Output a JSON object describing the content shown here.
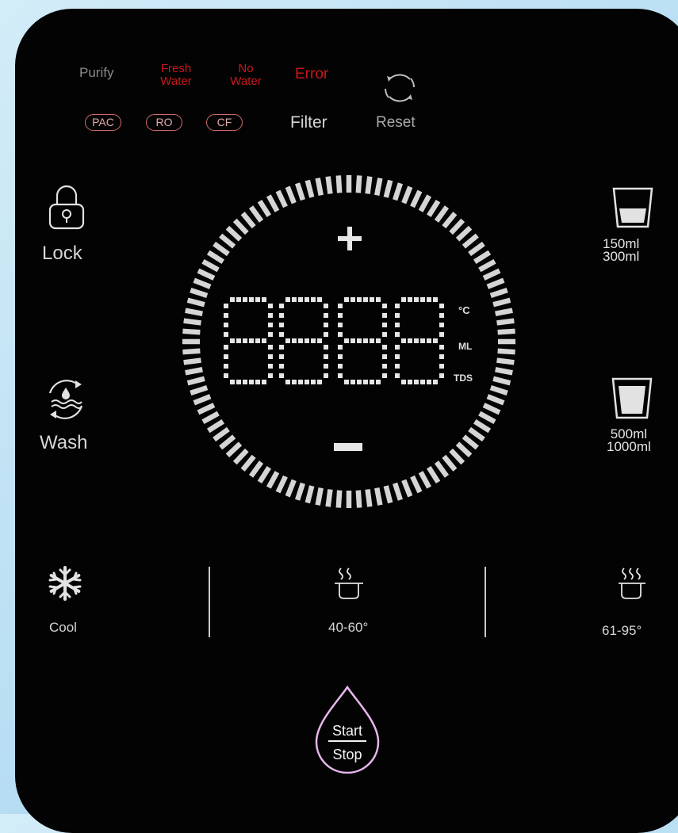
{
  "indicators": {
    "purify": "Purify",
    "fresh_water": [
      "Fresh",
      "Water"
    ],
    "no_water": [
      "No",
      "Water"
    ],
    "error": "Error"
  },
  "filters": [
    "PAC",
    "RO",
    "CF"
  ],
  "filter_label": "Filter",
  "reset_label": "Reset",
  "lock_label": "Lock",
  "wash_label": "Wash",
  "cool_label": "Cool",
  "warm_label": "40-60°",
  "hot_label": "61-95°",
  "cup_small": [
    "150ml",
    "300ml"
  ],
  "cup_large": [
    "500ml",
    "1000ml"
  ],
  "display": {
    "units": [
      "°C",
      "ML",
      "TDS"
    ]
  },
  "start_stop": [
    "Start",
    "Stop"
  ],
  "colors": {
    "panel": "#030303",
    "error_red": "#c8171c",
    "start_ring": "#e8b6ec"
  },
  "icons": [
    "lock-icon",
    "wash-icon",
    "snowflake-icon",
    "warm-cup-icon",
    "hot-cup-icon",
    "small-cup-icon",
    "large-cup-icon",
    "reset-icon",
    "plus-icon",
    "minus-icon",
    "water-drop-icon"
  ]
}
